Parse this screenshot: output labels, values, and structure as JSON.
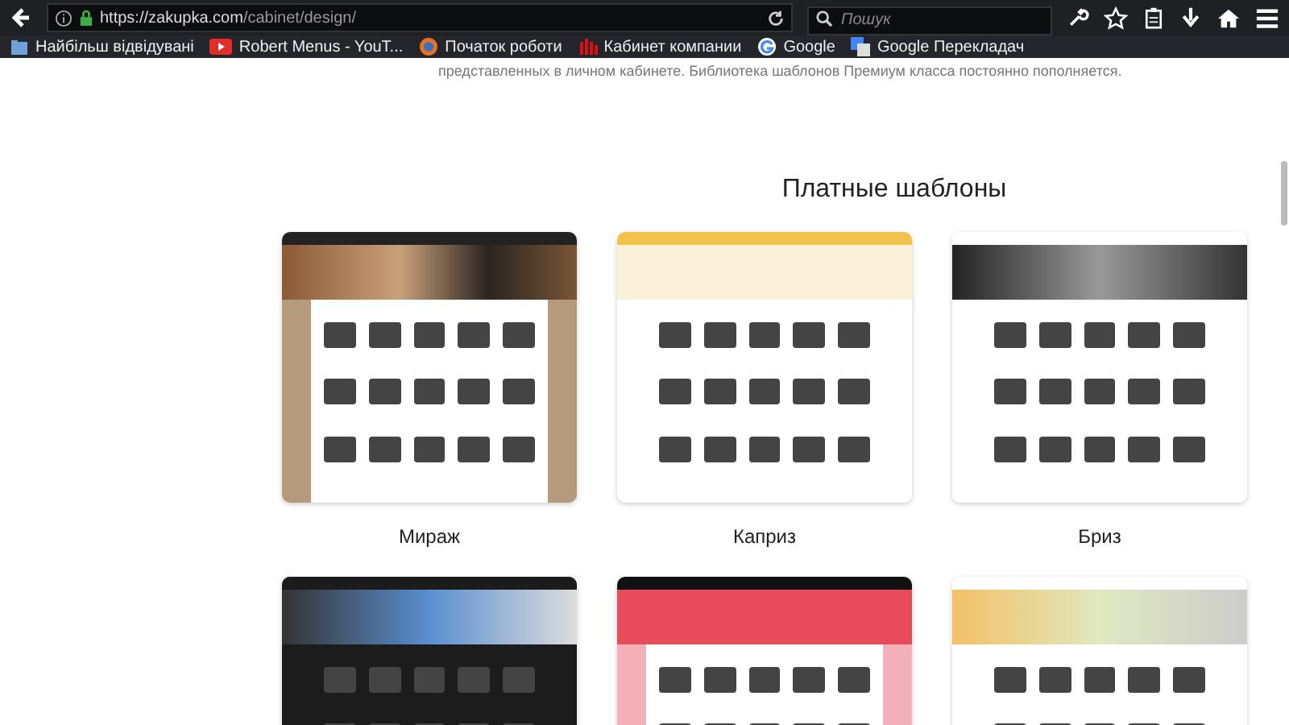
{
  "browser": {
    "url_host": "https://zakupka.com",
    "url_path": "/cabinet/design/",
    "search": {
      "placeholder": "Пошук"
    },
    "bookmarks": [
      {
        "label": "Найбільш відвідувані",
        "kind": "folder"
      },
      {
        "label": "Robert Menus - YouT...",
        "kind": "video"
      },
      {
        "label": "Початок роботи",
        "kind": "globe"
      },
      {
        "label": "Кабинет компании",
        "kind": "bars"
      },
      {
        "label": "Google",
        "kind": "g"
      },
      {
        "label": "Google Перекладач",
        "kind": "translate"
      }
    ]
  },
  "page": {
    "intro": "представленных в личном кабинете. Библиотека шаблонов Премиум класса постоянно пополняется.",
    "heading": "Платные шаблоны",
    "templates": [
      {
        "name": "Мираж",
        "kind": "brown"
      },
      {
        "name": "Каприз",
        "kind": "yellow"
      },
      {
        "name": "Бриз",
        "kind": "white"
      },
      {
        "kind": "dark"
      },
      {
        "kind": "red"
      },
      {
        "kind": "fresh"
      }
    ]
  }
}
